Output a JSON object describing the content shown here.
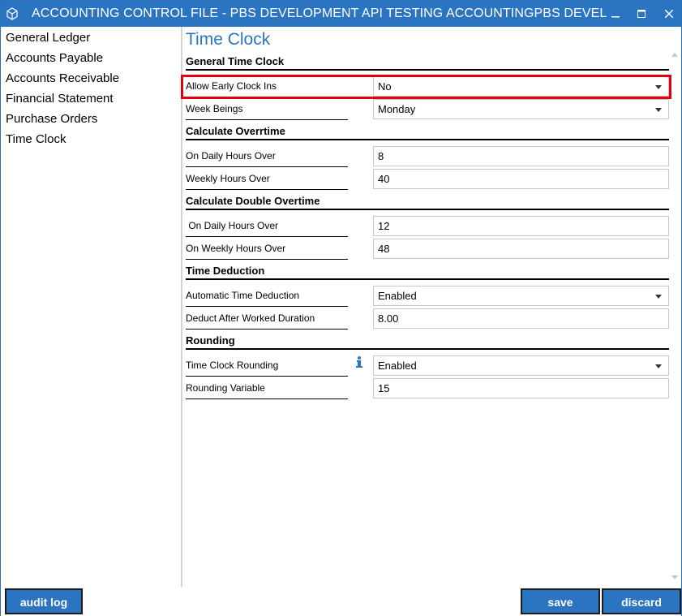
{
  "window": {
    "title": "ACCOUNTING CONTROL FILE - PBS DEVELOPMENT API TESTING ACCOUNTINGPBS DEVELOPMENT A...",
    "min_icon": "minimize-icon",
    "max_icon": "maximize-icon",
    "close_icon": "close-icon"
  },
  "sidebar": {
    "items": [
      {
        "label": "General Ledger"
      },
      {
        "label": "Accounts Payable"
      },
      {
        "label": "Accounts Receivable"
      },
      {
        "label": "Financial Statement"
      },
      {
        "label": "Purchase Orders"
      },
      {
        "label": "Time Clock"
      }
    ]
  },
  "main": {
    "title": "Time Clock",
    "sections": {
      "general": {
        "heading": "General Time Clock",
        "allow_early_label": "Allow Early Clock Ins",
        "allow_early_value": "No",
        "week_begins_label": "Week Beings",
        "week_begins_value": "Monday"
      },
      "overtime": {
        "heading": "Calculate Overrtime",
        "daily_label": "On Daily Hours Over",
        "daily_value": "8",
        "weekly_label": "Weekly Hours Over",
        "weekly_value": "40"
      },
      "double_overtime": {
        "heading": "Calculate Double Overtime",
        "daily_label": " On Daily Hours Over",
        "daily_value": "12",
        "weekly_label": "On Weekly Hours Over",
        "weekly_value": "48"
      },
      "deduction": {
        "heading": "Time Deduction",
        "auto_label": "Automatic Time Deduction",
        "auto_value": "Enabled",
        "after_label": "Deduct After Worked Duration",
        "after_value": "8.00"
      },
      "rounding": {
        "heading": "Rounding",
        "rounding_label": "Time Clock Rounding",
        "rounding_value": "Enabled",
        "variable_label": "Rounding Variable",
        "variable_value": "15"
      }
    }
  },
  "footer": {
    "audit_log": "audit log",
    "save": "save",
    "discard": "discard"
  },
  "colors": {
    "accent": "#2b74c2",
    "highlight": "#e0000f"
  }
}
